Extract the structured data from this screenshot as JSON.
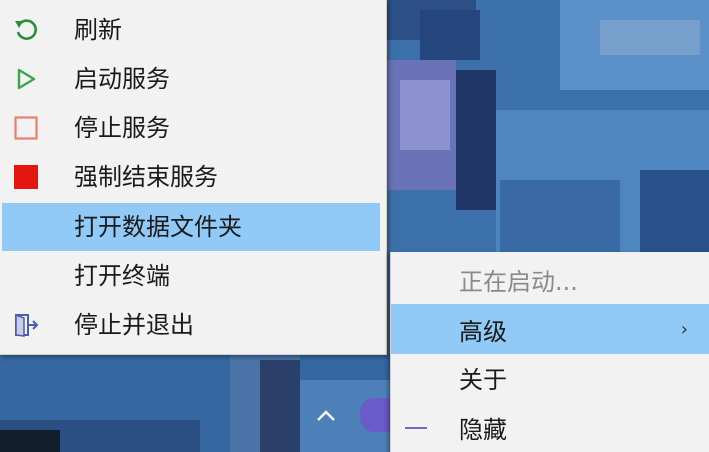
{
  "service_menu": {
    "items": [
      {
        "label": "刷新",
        "icon": "refresh-icon",
        "color": "#2e8b3e"
      },
      {
        "label": "启动服务",
        "icon": "play-icon",
        "color": "#3aa64a"
      },
      {
        "label": "停止服务",
        "icon": "stop-outline-icon",
        "color": "#e8806f"
      },
      {
        "label": "强制结束服务",
        "icon": "stop-filled-icon",
        "color": "#e3170f"
      },
      {
        "label": "打开数据文件夹",
        "icon": "",
        "highlighted": true
      },
      {
        "label": "打开终端",
        "icon": ""
      },
      {
        "label": "停止并退出",
        "icon": "exit-icon",
        "color": "#4a5fb0"
      }
    ]
  },
  "tray_menu": {
    "items": [
      {
        "label": "正在启动...",
        "disabled": true
      },
      {
        "label": "高级",
        "has_submenu": true,
        "highlighted": true
      },
      {
        "label": "关于"
      },
      {
        "label": "隐藏",
        "icon": "minus-icon"
      }
    ],
    "submenu_glyph": "›"
  },
  "colors": {
    "highlight": "#91c9f7",
    "menu_bg": "#f2f2f2",
    "desktop": "#3a6ea6"
  }
}
